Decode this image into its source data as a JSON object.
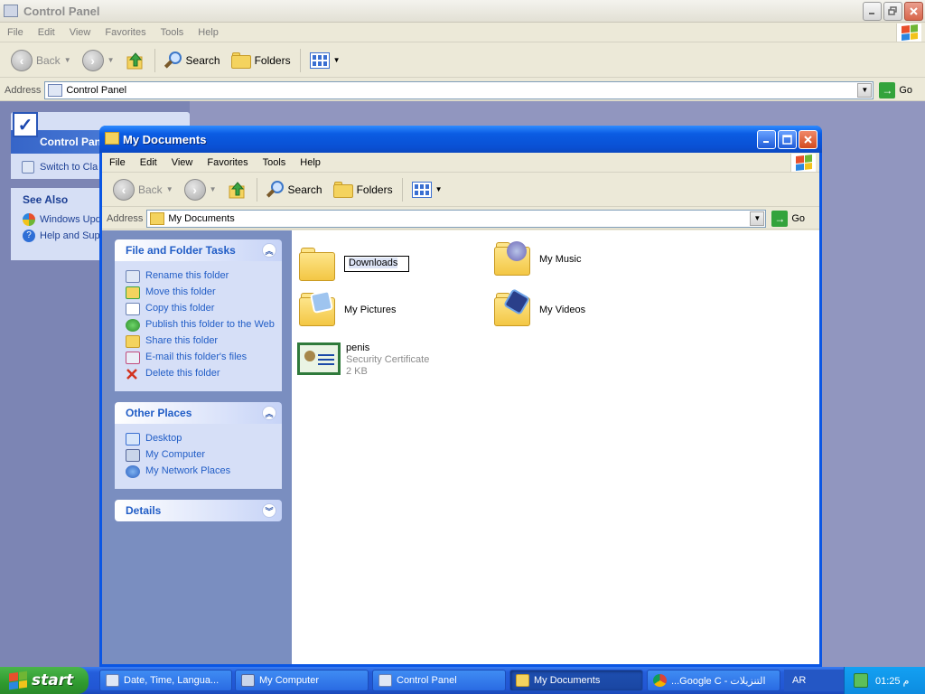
{
  "background_window": {
    "title": "Control Panel",
    "menu": [
      "File",
      "Edit",
      "View",
      "Favorites",
      "Tools",
      "Help"
    ],
    "toolbar": {
      "back": "Back",
      "search": "Search",
      "folders": "Folders"
    },
    "address": {
      "label": "Address",
      "value": "Control Panel",
      "go": "Go"
    },
    "left_pane": {
      "panel_title": "Control Panel",
      "switch_label": "Switch to Cla",
      "see_also_title": "See Also",
      "see_also_items": [
        "Windows Upd",
        "Help and Sup"
      ]
    }
  },
  "window": {
    "title": "My Documents",
    "menu": [
      "File",
      "Edit",
      "View",
      "Favorites",
      "Tools",
      "Help"
    ],
    "toolbar": {
      "back": "Back",
      "search": "Search",
      "folders": "Folders"
    },
    "address": {
      "label": "Address",
      "value": "My Documents",
      "go": "Go"
    },
    "tasks": {
      "file_folder": {
        "title": "File and Folder Tasks",
        "items": [
          "Rename this folder",
          "Move this folder",
          "Copy this folder",
          "Publish this folder to the Web",
          "Share this folder",
          "E-mail this folder's files",
          "Delete this folder"
        ]
      },
      "other_places": {
        "title": "Other Places",
        "items": [
          "Desktop",
          "My Computer",
          "My Network Places"
        ]
      },
      "details": {
        "title": "Details"
      }
    },
    "files": {
      "downloads": {
        "name": "Downloads"
      },
      "my_music": {
        "name": "My Music"
      },
      "my_pictures": {
        "name": "My Pictures"
      },
      "my_videos": {
        "name": "My Videos"
      },
      "cert": {
        "name": "penis",
        "type": "Security Certificate",
        "size": "2 KB"
      }
    }
  },
  "taskbar": {
    "start": "start",
    "buttons": [
      "Date, Time, Langua...",
      "My Computer",
      "Control Panel",
      "My Documents",
      "...Google C - التنزيلات"
    ],
    "language": "AR",
    "clock": "01:25 م"
  }
}
